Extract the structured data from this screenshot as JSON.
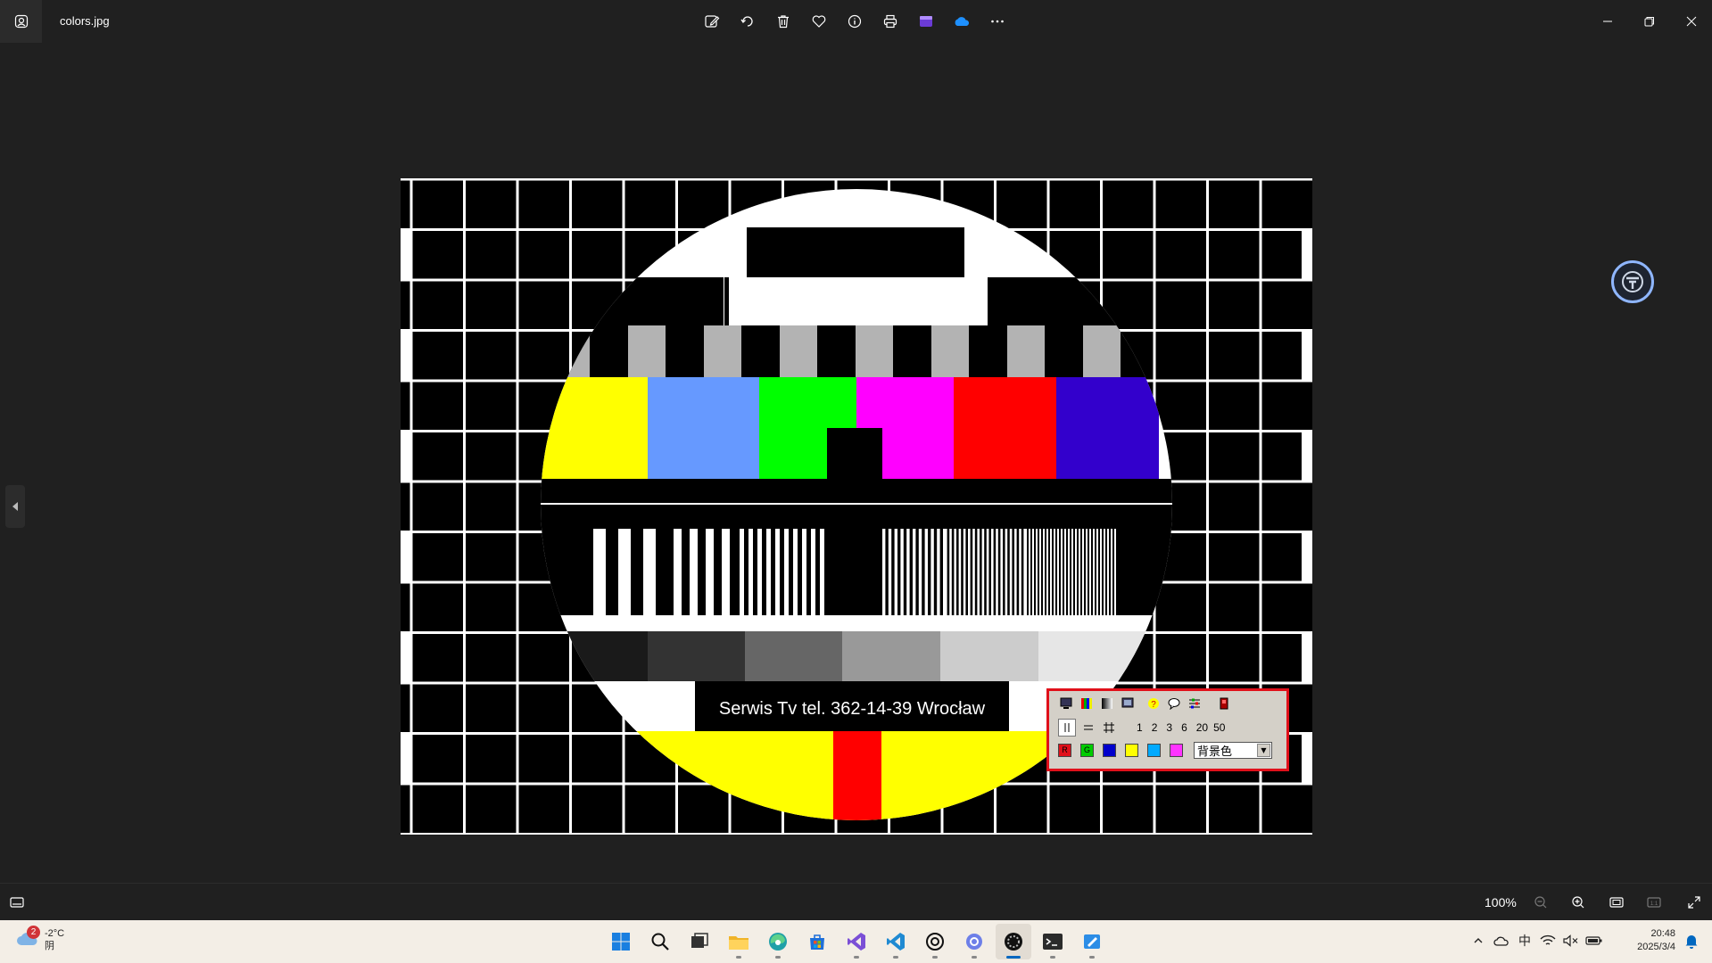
{
  "titlebar": {
    "filename": "colors.jpg",
    "toolbar": [
      {
        "icon": "edit-image-icon"
      },
      {
        "icon": "rotate-icon"
      },
      {
        "icon": "delete-icon"
      },
      {
        "icon": "favorite-heart-icon"
      },
      {
        "icon": "info-icon"
      },
      {
        "icon": "print-icon"
      },
      {
        "icon": "clipchamp-icon"
      },
      {
        "icon": "onedrive-cloud-icon"
      },
      {
        "icon": "more-icon"
      }
    ]
  },
  "testcard": {
    "caption": "Serwis Tv  tel. 362-14-39  Wrocław",
    "colorbars": [
      "#ffff00",
      "#6699ff",
      "#00ff00",
      "#ff00ff",
      "#ff0000",
      "#3300cc"
    ],
    "graybars": [
      "#1a1a1a",
      "#333333",
      "#666666",
      "#999999",
      "#cccccc",
      "#e6e6e6"
    ]
  },
  "widget": {
    "numbers": [
      "1",
      "2",
      "3",
      "6",
      "20",
      "50"
    ],
    "swatches": [
      {
        "label": "R",
        "color": "#e0101a"
      },
      {
        "label": "G",
        "color": "#00cc00"
      },
      {
        "label": "",
        "color": "#0000cc"
      },
      {
        "label": "",
        "color": "#ffff00"
      },
      {
        "label": "",
        "color": "#00aaff"
      },
      {
        "label": "",
        "color": "#ff33ff"
      }
    ],
    "select_value": "背景色"
  },
  "statusbar": {
    "zoom": "100%"
  },
  "taskbar": {
    "weather": {
      "temp": "-2°C",
      "condition": "阴",
      "badge": "2"
    },
    "apps": [
      {
        "icon": "windows-start-icon",
        "running": false
      },
      {
        "icon": "search-icon",
        "running": false
      },
      {
        "icon": "task-view-icon",
        "running": false
      },
      {
        "icon": "file-explorer-icon",
        "running": true
      },
      {
        "icon": "edge-browser-icon",
        "running": true
      },
      {
        "icon": "microsoft-store-icon",
        "running": false
      },
      {
        "icon": "visual-studio-icon",
        "running": true
      },
      {
        "icon": "vscode-icon",
        "running": true
      },
      {
        "icon": "chatgpt-icon",
        "running": true
      },
      {
        "icon": "copilot-icon",
        "running": true
      },
      {
        "icon": "photos-app-icon",
        "running": true,
        "active": true
      },
      {
        "icon": "terminal-icon",
        "running": true
      },
      {
        "icon": "paint-icon",
        "running": true
      }
    ],
    "tray": {
      "ime": "中"
    },
    "clock": {
      "time": "20:48",
      "date": "2025/3/4"
    }
  }
}
